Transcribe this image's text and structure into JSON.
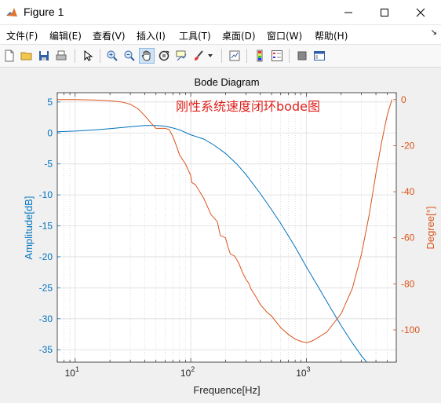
{
  "window": {
    "title": "Figure 1"
  },
  "menu": [
    "文件(F)",
    "编辑(E)",
    "查看(V)",
    "插入(I)",
    "工具(T)",
    "桌面(D)",
    "窗口(W)",
    "帮助(H)"
  ],
  "toolbar": [
    "new-figure",
    "open-file",
    "save",
    "print",
    "pointer",
    "zoom-in",
    "zoom-out",
    "pan",
    "rotate-3d",
    "data-cursor",
    "brush",
    "link-plot",
    "colorbar",
    "legend",
    "hide-plot-tools",
    "show-plot-tools"
  ],
  "colors": {
    "amplitude": "#0072BD",
    "phase": "#D95319",
    "annotation": "#e0201b"
  },
  "chart_data": {
    "type": "line",
    "title": "Bode Diagram",
    "annotation": "刚性系统速度闭环bode图",
    "xlabel": "Frequence[Hz]",
    "ylabel_left": "Amplitude[dB]",
    "ylabel_right": "Degree[°]",
    "x_scale": "log",
    "xlim": [
      7,
      6000
    ],
    "ylim_left": [
      -37,
      6.5
    ],
    "ylim_right": [
      -114,
      3
    ],
    "x_ticks": [
      {
        "base": "10",
        "exp": "1"
      },
      {
        "base": "10",
        "exp": "2"
      },
      {
        "base": "10",
        "exp": "3"
      }
    ],
    "y_ticks_left": [
      "5",
      "0",
      "-5",
      "-10",
      "-15",
      "-20",
      "-25",
      "-30",
      "-35"
    ],
    "y_ticks_right": [
      "0",
      "-20",
      "-40",
      "-60",
      "-80",
      "-100"
    ],
    "grid": true,
    "series": [
      {
        "axis": "left",
        "x": [
          7,
          10,
          15,
          20,
          30,
          40,
          50,
          60,
          70,
          80,
          100,
          130,
          160,
          200,
          250,
          300,
          400,
          500,
          600,
          800,
          1000,
          1300,
          1600,
          2000,
          2500,
          3000,
          3500,
          4000,
          4500
        ],
        "y": [
          0.2,
          0.3,
          0.5,
          0.7,
          1.0,
          1.2,
          1.2,
          1.1,
          0.8,
          0.5,
          -0.3,
          -1.0,
          -2.0,
          -3.3,
          -5.0,
          -6.7,
          -9.8,
          -12.4,
          -14.6,
          -18.4,
          -21.6,
          -25.2,
          -28.1,
          -31.1,
          -33.9,
          -36.0,
          -37.5,
          -38.7,
          -39.8
        ]
      },
      {
        "axis": "right",
        "x": [
          7,
          10,
          15,
          20,
          25,
          30,
          35,
          40,
          45,
          50,
          60,
          65,
          70,
          75,
          80,
          90,
          100,
          102,
          110,
          130,
          150,
          170,
          180,
          200,
          210,
          220,
          240,
          260,
          270,
          280,
          300,
          320,
          330,
          350,
          370,
          400,
          450,
          500,
          600,
          700,
          800,
          900,
          1000,
          1100,
          1200,
          1500,
          2000,
          2500,
          3000,
          3500,
          4000,
          4500,
          5000,
          5500
        ],
        "y": [
          0,
          0,
          -0.2,
          -0.5,
          -1,
          -2,
          -4,
          -7,
          -10,
          -12.5,
          -12.5,
          -13,
          -16,
          -20,
          -24,
          -28,
          -33,
          -36,
          -37,
          -43,
          -50,
          -53,
          -59,
          -60,
          -64,
          -67,
          -68,
          -71,
          -73,
          -75,
          -78,
          -80,
          -82,
          -84,
          -86,
          -89,
          -92,
          -94,
          -99,
          -102,
          -104,
          -105,
          -105.5,
          -105,
          -104,
          -101,
          -93,
          -82,
          -67,
          -50,
          -32,
          -18,
          -7,
          0
        ]
      }
    ]
  }
}
